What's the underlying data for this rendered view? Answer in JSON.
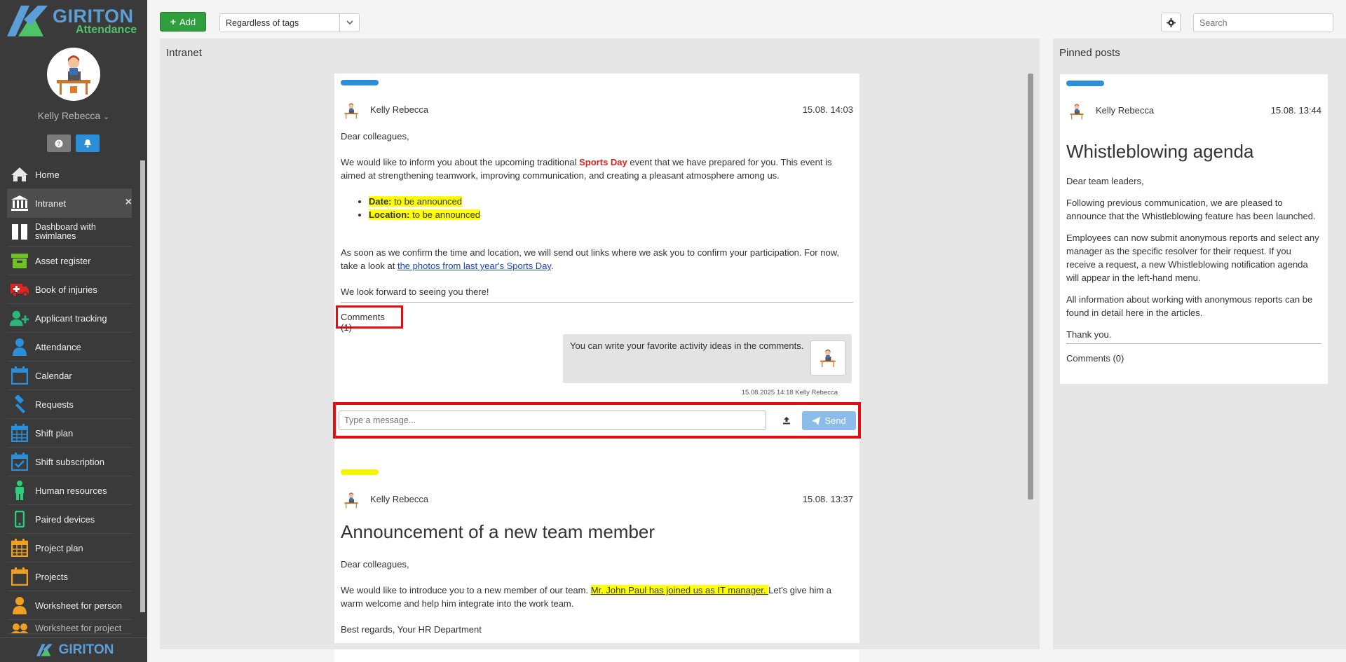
{
  "app": {
    "logo_name": "GIRITON",
    "logo_sub": "Attendance",
    "footer_logo": "GIRITON"
  },
  "profile": {
    "name": "Kelly Rebecca",
    "caret": "⌄"
  },
  "sidebar": {
    "items": [
      {
        "label": "Home",
        "icon": "home-icon"
      },
      {
        "label": "Intranet",
        "icon": "institution-icon"
      },
      {
        "label": "Dashboard with swimlanes",
        "icon": "columns-icon"
      },
      {
        "label": "Asset register",
        "icon": "archive-icon"
      },
      {
        "label": "Book of injuries",
        "icon": "ambulance-icon"
      },
      {
        "label": "Applicant tracking",
        "icon": "user-plus-icon"
      },
      {
        "label": "Attendance",
        "icon": "person-icon"
      },
      {
        "label": "Calendar",
        "icon": "calendar-icon"
      },
      {
        "label": "Requests",
        "icon": "gavel-icon"
      },
      {
        "label": "Shift plan",
        "icon": "calendar-grid-icon"
      },
      {
        "label": "Shift subscription",
        "icon": "calendar-check-icon"
      },
      {
        "label": "Human resources",
        "icon": "male-icon"
      },
      {
        "label": "Paired devices",
        "icon": "mobile-icon"
      },
      {
        "label": "Project plan",
        "icon": "calendar-grid-icon"
      },
      {
        "label": "Projects",
        "icon": "calendar-icon"
      },
      {
        "label": "Worksheet for person",
        "icon": "person-icon"
      },
      {
        "label": "Worksheet for project",
        "icon": "users-icon"
      }
    ]
  },
  "toolbar": {
    "add_label": "Add",
    "tags_selected": "Regardless of tags",
    "search_placeholder": "Search"
  },
  "main": {
    "title": "Intranet",
    "posts": [
      {
        "bar_color": "#2a8ed8",
        "author": "Kelly Rebecca",
        "date": "15.08. 14:03",
        "greeting": "Dear colleagues,",
        "p1_a": "We would like to inform you about the upcoming traditional ",
        "p1_highlight": "Sports Day",
        "p1_b": " event that we have prepared for you. This event is aimed at strengthening teamwork, improving communication, and creating a pleasant atmosphere among us.",
        "li1_label": "Date:",
        "li1_value": " to be announced",
        "li2_label": "Location:",
        "li2_value": " to be announced",
        "p2_a": "As soon as we confirm the time and location, we will send out links where we ask you to confirm your participation. For now, take a look at ",
        "p2_link": "the photos from last year's Sports Day",
        "p2_b": ".",
        "closing": "We look forward to seeing you there!",
        "comments_label": "Comments (1)",
        "comment_text": "You can write your favorite activity ideas in the comments.",
        "comment_meta": "15.08.2025 14:18 Kelly Rebecca",
        "message_placeholder": "Type a message...",
        "send_label": "Send"
      },
      {
        "bar_color": "#f5f500",
        "author": "Kelly Rebecca",
        "date": "15.08. 13:37",
        "title": "Announcement of a new team member",
        "greeting": "Dear colleagues,",
        "p1_a": "We would like to introduce you to a new member of our team. ",
        "p1_highlight": "Mr. John Paul has joined us as IT manager. ",
        "p1_b": "Let's give him a warm welcome and help him integrate into the work team.",
        "closing": "Best regards, Your HR Department"
      }
    ]
  },
  "pinned": {
    "title": "Pinned posts",
    "post": {
      "bar_color": "#2a8ed8",
      "author": "Kelly Rebecca",
      "date": "15.08. 13:44",
      "title": "Whistleblowing agenda",
      "greeting": "Dear team leaders,",
      "p1": "Following previous communication, we are pleased to announce that the Whistleblowing feature has been launched.",
      "p2": "Employees can now submit anonymous reports and select any manager as the specific resolver for their request. If you receive a request, a new Whistleblowing notification agenda will appear in the left-hand menu.",
      "p3": "All information about working with anonymous reports can be found in detail here in the articles.",
      "closing": "Thank you.",
      "comments_label": "Comments (0)"
    }
  }
}
